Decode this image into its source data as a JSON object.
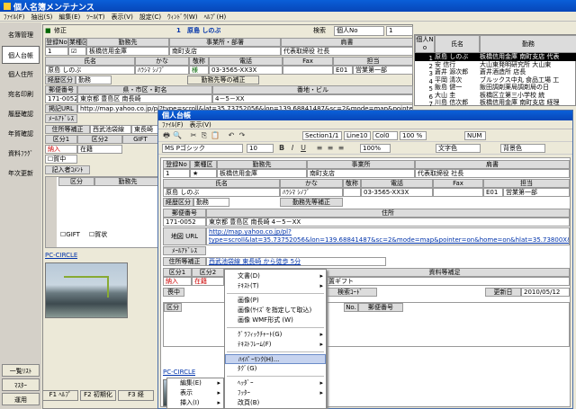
{
  "main_window": {
    "title": "個人名簿メンテナンス",
    "menu": [
      "ﾌｧｲﾙ(F)",
      "抽出(S)",
      "編集(E)",
      "ﾂｰﾙ(T)",
      "表示(V)",
      "設定(C)",
      "ｳｨﾝﾄﾞｳ(W)",
      "ﾍﾙﾌﾟ(H)"
    ]
  },
  "sidebar": {
    "items": [
      "名簿管理",
      "個人台帳",
      "個人住所",
      "宛名印刷",
      "履歴確認",
      "年賀確認",
      "資料ﾌﾗｸﾞ",
      "年次更新"
    ],
    "bottom": [
      "一覧ﾘｽﾄ",
      "ﾏｽﾀｰ",
      "運用"
    ]
  },
  "back_form": {
    "edit_label": "修正",
    "record_no": "1",
    "person_name": "原島 しのぶ",
    "search_label": "検索",
    "search_field": "個人No",
    "search_value": "1",
    "headers": [
      "登録No",
      "業種区",
      "勤務先",
      "事業所・部署",
      "肩書"
    ],
    "row1": {
      "no": "1",
      "company": "板橋信用金庫",
      "branch": "南町支店",
      "title": "代表取締役 社長"
    },
    "headers2": [
      "氏名",
      "かな",
      "敬称",
      "電話",
      "Fax",
      "担当"
    ],
    "row2": {
      "name": "原島 しのぶ",
      "kana": "ﾊﾗｼﾏ ｼﾉﾌﾞ",
      "honorific": "様",
      "phone": "03-3565-XX3X",
      "fax": "",
      "staff_code": "E01",
      "staff": "営業第一部"
    },
    "work_label": "経歴区分",
    "work_value": "勤務",
    "work_btn": "勤務先等の補正",
    "headers3": [
      "郵便番号",
      "県・市区・町名",
      "番地・ビル"
    ],
    "row3": {
      "zip": "171-0052",
      "addr1": "東京都 豊島区 南長崎",
      "addr2": "4－5－XX"
    },
    "url_label": "掲記URL",
    "url": "http://map.yahoo.co.jp/pl?type=scroll&lat=35.73752056&lon=139.68841487&sc=2&mode=map&pointer=on&home=on&hlat=35.7398",
    "mail_label": "ﾒｰﾙｱﾄﾞﾚｽ",
    "tabs": [
      "住所等補正",
      "西武池袋線",
      "東長崎"
    ],
    "kubun": "区分1",
    "kubun2": "区分2",
    "gift": "GIFT",
    "kubun_row": [
      "納入",
      "在籍"
    ],
    "check": "賀中",
    "kinyu": "記入者ｺﾒﾝﾄ",
    "section_label": "区分",
    "section_label2": "勤務先",
    "cb1": "GIFT",
    "cb2": "賀状",
    "pc_circle": "PC-CIRCLE"
  },
  "right_list": {
    "header_no": "個人N o",
    "header_name": "氏名",
    "header_work": "勤務",
    "rows": [
      {
        "no": "1",
        "name": "原島 しのぶ",
        "work": "板橋信用金庫 南町支店 代表"
      },
      {
        "no": "2",
        "name": "安 信行",
        "work": "大山東発明研究所 大山東"
      },
      {
        "no": "3",
        "name": "蒼井 源次郎",
        "work": "蒼井酒造所 店長"
      },
      {
        "no": "4",
        "name": "平岡 清次",
        "work": "ブルックス中丸 食品工場 工"
      },
      {
        "no": "5",
        "name": "飯島 健一",
        "work": "飯田調剤薬局調剤局の日 "
      },
      {
        "no": "6",
        "name": "大山 圭",
        "work": "板橋区立第三小学校 統"
      },
      {
        "no": "7",
        "name": "川島 信次郎",
        "work": "板橋信用金庫 南町支店 経理"
      }
    ]
  },
  "fkeys": [
    "F1 ﾍﾙﾌﾟ",
    "F2 初期化",
    "F3 経"
  ],
  "front": {
    "title": "個人台帳",
    "menu": [
      "ﾌｧｲﾙ(F)",
      "表示(V)"
    ],
    "section": "Section1/1",
    "line": "Line10",
    "col": "Col0",
    "zoom": "100 %",
    "num": "NUM",
    "font": "MS Pゴシック",
    "size": "10",
    "zoom2": "100%",
    "style_label": "文字色",
    "color_label": "背景色",
    "headers": [
      "登録No",
      "業種区",
      "勤務先",
      "事業所",
      "肩書"
    ],
    "row1": {
      "no": "1",
      "mark": "★",
      "company": "板橋信用金庫",
      "branch": "南町支店",
      "title": "代表取締役 社長"
    },
    "headers2": [
      "氏名",
      "かな",
      "敬称",
      "電話",
      "Fax",
      "担当"
    ],
    "row2": {
      "name": "原島 しのぶ",
      "kana": "ﾊﾗｼﾏ ｼﾉﾌﾞ",
      "phone": "03-3565-XX3X",
      "staff_code": "E01",
      "staff": "営業第一部"
    },
    "work_label": "経歴区分",
    "work_value": "勤務",
    "work_btn": "勤務先等補正",
    "headers3": [
      "郵便番号",
      "住所"
    ],
    "row3": {
      "zip": "171-0052",
      "addr": "東京都 豊島区 南長崎 4－5－XX"
    },
    "url_label": "地図 URL",
    "url": "http://map.yahoo.co.jp/pl?type=scroll&lat=35.73752056&lon=139.68841487&sc=2&mode=map&pointer=on&home=on&hlat=35.73800X&hlon=139.688210X",
    "mail_label": "ﾒｰﾙｱﾄﾞﾚｽ",
    "access_label": "住所等補正",
    "access": "西武池袋線 東長崎 から徒歩 5分",
    "kubun_headers": [
      "区分1",
      "区分2",
      "年賀",
      "法務",
      "喪中",
      "その他",
      "資料等補足"
    ],
    "kubun_row": [
      "納入",
      "在籍",
      "出受",
      "",
      "出受",
      "",
      "座置ギフト"
    ],
    "mochu": "喪中",
    "search_code": "検索ｺｰﾄﾞ",
    "updated_label": "更新日",
    "updated": "2010/05/12",
    "lower_headers": [
      "区分",
      "",
      "No.",
      "郵便番号"
    ],
    "pc_circle": "PC-CIRCLE"
  },
  "context_menu": {
    "items": [
      {
        "label": "文書(D)",
        "arrow": true
      },
      {
        "label": "ﾃｷｽﾄ(T)",
        "arrow": true
      },
      {
        "sep": true
      },
      {
        "label": "画像(P)"
      },
      {
        "label": "画像(ｻｲｽﾞを指定して取込)"
      },
      {
        "label": "画像 WMF形式 (W)"
      },
      {
        "sep": true
      },
      {
        "label": "ｸﾞﾗﾌｨｯｸﾁｬｰﾄ(G)",
        "arrow": true
      },
      {
        "label": "ﾃｷｽﾄﾌﾚｰﾑ(F)",
        "arrow": true
      },
      {
        "sep": true
      },
      {
        "label": "ﾊｲﾊﾟｰﾘﾝｸ(H)...",
        "hl": true
      },
      {
        "label": "ﾀｸﾞ(G)"
      },
      {
        "sep": true
      },
      {
        "label": "ﾍｯﾀﾞｰ",
        "arrow": true
      },
      {
        "label": "ﾌｯﾀｰ",
        "arrow": true
      },
      {
        "label": "改頁(B)"
      }
    ],
    "parent": [
      {
        "label": "編集(E)",
        "arrow": true
      },
      {
        "label": "表示",
        "arrow": true
      },
      {
        "label": "挿入(I)",
        "arrow": true
      }
    ]
  }
}
